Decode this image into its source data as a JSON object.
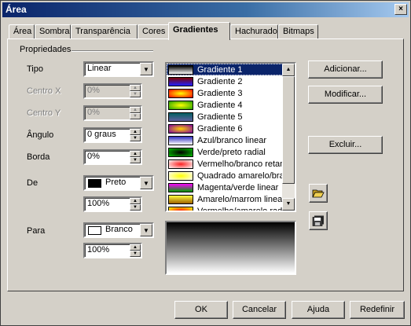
{
  "window": {
    "title": "Área",
    "close_glyph": "×"
  },
  "tabs": [
    {
      "label": "Área",
      "active": false
    },
    {
      "label": "Sombra",
      "active": false
    },
    {
      "label": "Transparência",
      "active": false
    },
    {
      "label": "Cores",
      "active": false
    },
    {
      "label": "Gradientes",
      "active": true
    },
    {
      "label": "Hachurado",
      "active": false
    },
    {
      "label": "Bitmaps",
      "active": false
    }
  ],
  "properties": {
    "group_label": "Propriedades",
    "tipo": {
      "label": "Tipo",
      "value": "Linear"
    },
    "centro_x": {
      "label": "Centro X",
      "value": "0%",
      "disabled": true
    },
    "centro_y": {
      "label": "Centro Y",
      "value": "0%",
      "disabled": true
    },
    "angulo": {
      "label": "Ângulo",
      "value": "0 graus"
    },
    "borda": {
      "label": "Borda",
      "value": "0%"
    },
    "de": {
      "label": "De",
      "color_name": "Preto",
      "color": "#000000",
      "intensity": "100%"
    },
    "para": {
      "label": "Para",
      "color_name": "Branco",
      "color": "#ffffff",
      "intensity": "100%"
    }
  },
  "gradient_list": {
    "selected_index": 0,
    "items": [
      {
        "label": "Gradiente 1",
        "from": "#000000",
        "to": "#ffffff",
        "type": "linear"
      },
      {
        "label": "Gradiente 2",
        "from": "#7a0000",
        "to": "#2020ff",
        "type": "linear"
      },
      {
        "label": "Gradiente 3",
        "from": "#ff0000",
        "to": "#ffff00",
        "type": "radial"
      },
      {
        "label": "Gradiente 4",
        "from": "#20a000",
        "to": "#ffff00",
        "type": "radial"
      },
      {
        "label": "Gradiente 5",
        "from": "#006060",
        "to": "#6060a0",
        "type": "linear"
      },
      {
        "label": "Gradiente 6",
        "from": "#8000a0",
        "to": "#ffd000",
        "type": "radial"
      },
      {
        "label": "Azul/branco linear",
        "from": "#3030c0",
        "to": "#ffffff",
        "type": "linear"
      },
      {
        "label": "Verde/preto radial",
        "from": "#00c000",
        "to": "#000000",
        "type": "radial"
      },
      {
        "label": "Vermelho/branco retangular",
        "from": "#ffffff",
        "to": "#ff2020",
        "type": "radial"
      },
      {
        "label": "Quadrado amarelo/branco",
        "from": "#ffffff",
        "to": "#ffff00",
        "type": "radial"
      },
      {
        "label": "Magenta/verde linear",
        "from": "#ff00ff",
        "to": "#00a000",
        "type": "linear"
      },
      {
        "label": "Amarelo/marrom linear",
        "from": "#ffff40",
        "to": "#a06000",
        "type": "linear"
      },
      {
        "label": "Vermelho/amarelo radial",
        "from": "#ffff00",
        "to": "#ff0000",
        "type": "radial"
      }
    ]
  },
  "preview": {
    "from": "#000000",
    "to": "#ffffff"
  },
  "actions": {
    "adicionar": "Adicionar...",
    "modificar": "Modificar...",
    "excluir": "Excluir...",
    "load_icon": "folder-open-icon",
    "save_icon": "save-icon"
  },
  "footer": {
    "ok": "OK",
    "cancelar": "Cancelar",
    "ajuda": "Ajuda",
    "redefinir": "Redefinir"
  }
}
